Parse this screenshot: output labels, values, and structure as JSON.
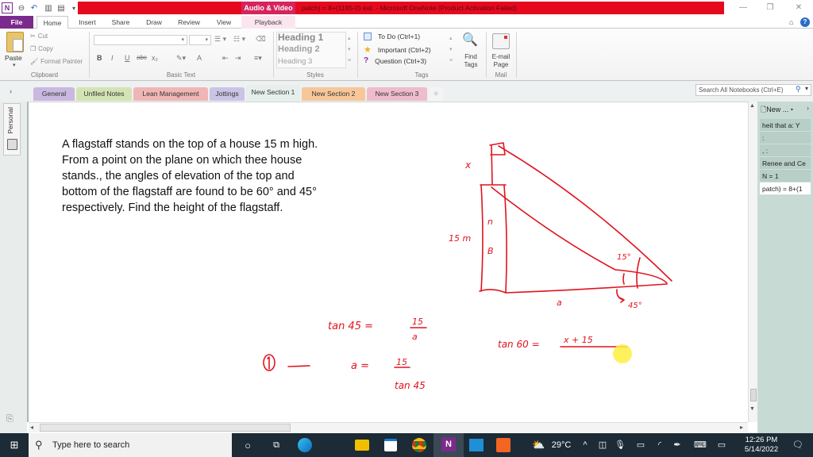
{
  "window": {
    "context_tab_group": "Audio & Video",
    "title": "patch) = 8+(1185-0) eat. - Microsoft OneNote (Product Activation Failed)",
    "controls": {
      "minimize": "—",
      "restore": "❐",
      "close": "✕"
    }
  },
  "ribbon_tabs": [
    "File",
    "Home",
    "Insert",
    "Share",
    "Draw",
    "Review",
    "View",
    "Playback"
  ],
  "ribbon": {
    "clipboard": {
      "paste": "Paste",
      "cut": "Cut",
      "copy": "Copy",
      "format_painter": "Format Painter",
      "label": "Clipboard"
    },
    "basic_text": {
      "label": "Basic Text",
      "bold": "B",
      "italic": "I",
      "underline": "U",
      "strike": "abc",
      "subscript": "x₂",
      "font_color": "A"
    },
    "styles": {
      "label": "Styles",
      "items": [
        "Heading 1",
        "Heading 2",
        "Heading 3"
      ]
    },
    "tags": {
      "label": "Tags",
      "items": [
        "To Do (Ctrl+1)",
        "Important (Ctrl+2)",
        "Question (Ctrl+3)"
      ],
      "find_tags": [
        "Find",
        "Tags"
      ]
    },
    "mail": {
      "label": "Mail",
      "email_page": [
        "E-mail",
        "Page"
      ]
    }
  },
  "section_tabs": [
    {
      "label": "General",
      "color": "#c9b8e0"
    },
    {
      "label": "Unfiled Notes",
      "color": "#d4e3b4"
    },
    {
      "label": "Lean Management",
      "color": "#f0b6b6"
    },
    {
      "label": "Jottings",
      "color": "#cbc4e6"
    },
    {
      "label": "New Section 1",
      "color": "#e6efec",
      "active": true
    },
    {
      "label": "New Section 2",
      "color": "#f7c79a"
    },
    {
      "label": "New Section 3",
      "color": "#efbccd"
    }
  ],
  "search": {
    "placeholder": "Search All Notebooks (Ctrl+E)"
  },
  "notebook": {
    "name": "Personal"
  },
  "page": {
    "question_lines": [
      "A flagstaff stands on the top of a house 15 m high.",
      "From a point on the plane on which thee house",
      "stands., the angles of elevation of the top and",
      "bottom of the flagstaff are found to be 60° and 45°",
      "respectively. Find the height of the flagstaff."
    ],
    "ink_annotations": {
      "flag_label": "x",
      "house_label": "15 m",
      "base_label": "a",
      "angle_top": "15°",
      "angle_bottom": "45°",
      "eq1": "tan 45 = 15 / a",
      "eq1_marker": "①",
      "eq2": "a = 15 / tan 45",
      "eq3": "tan 60 = (x + 15) / ..."
    }
  },
  "page_list": {
    "new_page": "New ...",
    "items": [
      "heit that a: Y",
      ":",
      ", :",
      "Renee and Ce",
      "N = 1",
      "patch) = 8+(1"
    ]
  },
  "taskbar": {
    "search_placeholder": "Type here to search",
    "weather": "29°C",
    "time": "12:26 PM",
    "date": "5/14/2022"
  },
  "colors": {
    "accent_red": "#e6091e",
    "file_tab": "#7b2b8c",
    "ink": "#e0141e",
    "taskbar": "#1c2b36"
  }
}
